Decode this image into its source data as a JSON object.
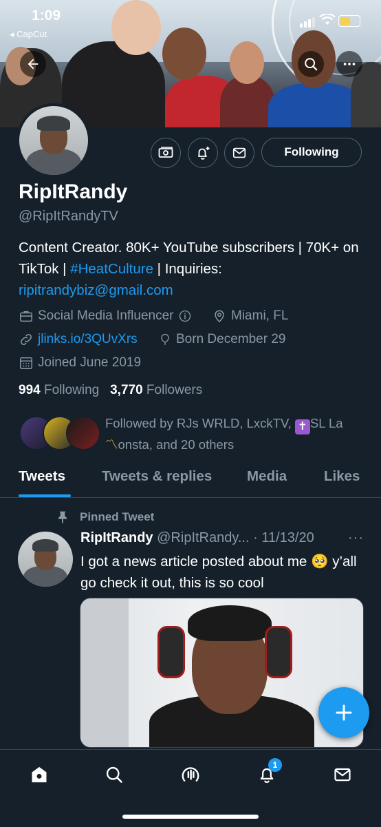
{
  "status_bar": {
    "time": "1:09",
    "back_app": "◂ CapCut"
  },
  "profile": {
    "name": "RipItRandy",
    "handle": "@RipItRandyTV",
    "bio_prefix": "Content Creator. 80K+ YouTube subscribers | 70K+ on TikTok | ",
    "bio_hashtag": "#HeatCulture",
    "bio_mid": " | Inquiries: ",
    "bio_email": "ripitrandybiz@gmail.com",
    "category": "Social Media Influencer",
    "location": "Miami, FL",
    "website": "jlinks.io/3QUvXrs",
    "birthday": "Born December 29",
    "joined": "Joined June 2019",
    "following_count": "994",
    "following_label": "Following",
    "followers_count": "3,770",
    "followers_label": "Followers",
    "followed_by_prefix": "Followed by RJs WRLD, LxckTV, ",
    "followed_by_cross": "✝",
    "followed_by_name2": "SL La",
    "followed_by_mark": "〽",
    "followed_by_suffix": "onsta, and 20 others"
  },
  "actions": {
    "following_button": "Following"
  },
  "tabs": [
    {
      "label": "Tweets",
      "active": true
    },
    {
      "label": "Tweets & replies",
      "active": false
    },
    {
      "label": "Media",
      "active": false
    },
    {
      "label": "Likes",
      "active": false
    }
  ],
  "pinned_tweet": {
    "pinned_label": "Pinned Tweet",
    "author": "RipItRandy",
    "handle_date": "@RipItRandy... · 11/13/20",
    "more": "···",
    "text": "I got a news article posted about me 🥺 y’all go check it out, this is so cool"
  },
  "bottom_nav": {
    "notification_badge": "1"
  },
  "colors": {
    "background": "#15202b",
    "accent": "#1d9bf0",
    "muted": "#8b98a5",
    "border": "#38444d"
  }
}
